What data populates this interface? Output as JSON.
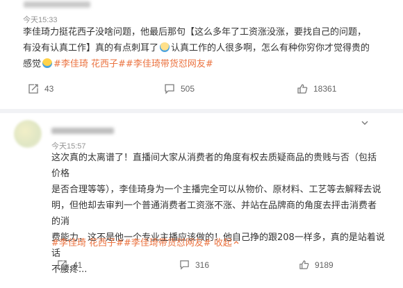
{
  "post1": {
    "time": "今天15:33",
    "line1": "李佳琦力挺花西子没啥问题，他最后那句【这么多年了工资涨没涨，要找自己的问题，",
    "line2a": "有没有认真工作】真的有点刺耳了",
    "line2b": "认真工作的人很多啊，怎么有种你穷你才觉得贵的",
    "line3a": "感觉",
    "tags": "#李佳琦 花西子##李佳琦带货怼网友#",
    "actions": {
      "repost": "43",
      "comment": "505",
      "like": "18361"
    }
  },
  "post2": {
    "time": "今天15:57",
    "lines": [
      "这次真的太离谱了！直播间大家从消费者的角度有权去质疑商品的贵贱与否（包括价格",
      "是否合理等等），李佳琦身为一个主播完全可以从物价、原材料、工艺等去解释去说",
      "明，但他却去审判一个普通消费者工资涨不涨、并站在品牌商的角度去抨击消费者的消",
      "费能力，这不是他一个专业主播应该做的！他自己挣的跟208一样多，真的是站着说话",
      "不腰疼..."
    ],
    "tags": "#李佳琦 花西子##李佳琦带货怼网友#",
    "collapse": "收起",
    "actions": {
      "repost": "41",
      "comment": "316",
      "like": "9189"
    }
  },
  "colors": {
    "tag": "#eb7340",
    "time": "#939393",
    "text": "#333333",
    "action": "#636363"
  },
  "icons": [
    "repost-icon",
    "comment-icon",
    "like-icon",
    "chevron-down-icon",
    "chevron-up-icon",
    "emoji-sad-icon",
    "emoji-crying-icon"
  ]
}
